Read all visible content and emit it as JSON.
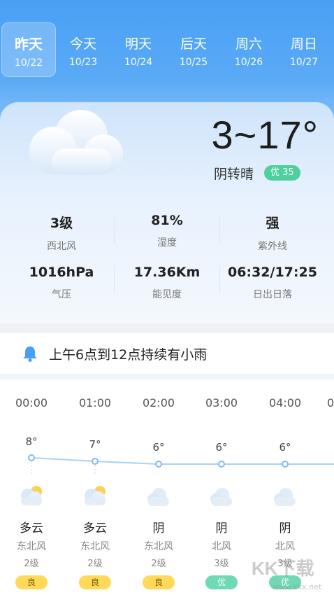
{
  "days": [
    {
      "name": "昨天",
      "date": "10/22",
      "active": true
    },
    {
      "name": "今天",
      "date": "10/23",
      "active": false
    },
    {
      "name": "明天",
      "date": "10/24",
      "active": false
    },
    {
      "name": "后天",
      "date": "10/25",
      "active": false
    },
    {
      "name": "周六",
      "date": "10/26",
      "active": false
    },
    {
      "name": "周日",
      "date": "10/27",
      "active": false
    }
  ],
  "today": {
    "temp_range": "3~17°",
    "condition": "阴转晴",
    "aqi_label": "优 35",
    "aqi_color": "#4fcf9c"
  },
  "stats": [
    {
      "value": "3级",
      "label": "西北风"
    },
    {
      "value": "81%",
      "label": "湿度"
    },
    {
      "value": "强",
      "label": "紫外线"
    },
    {
      "value": "1016hPa",
      "label": "气压"
    },
    {
      "value": "17.36Km",
      "label": "能见度"
    },
    {
      "value": "06:32/17:25",
      "label": "日出日落"
    }
  ],
  "alert": {
    "text": "上午6点到12点持续有小雨",
    "icon": "bell-icon"
  },
  "hourly": [
    {
      "time": "00:00",
      "temp": "8°",
      "icon": "partly-cloudy-icon",
      "weather": "多云",
      "wind_dir": "东北风",
      "wind_level": "2级",
      "aqi": "良",
      "aqi_class": "liang"
    },
    {
      "time": "01:00",
      "temp": "7°",
      "icon": "partly-cloudy-icon",
      "weather": "多云",
      "wind_dir": "东北风",
      "wind_level": "2级",
      "aqi": "良",
      "aqi_class": "liang"
    },
    {
      "time": "02:00",
      "temp": "6°",
      "icon": "cloud-icon",
      "weather": "阴",
      "wind_dir": "东北风",
      "wind_level": "2级",
      "aqi": "良",
      "aqi_class": "liang"
    },
    {
      "time": "03:00",
      "temp": "6°",
      "icon": "cloud-icon",
      "weather": "阴",
      "wind_dir": "北风",
      "wind_level": "3级",
      "aqi": "优",
      "aqi_class": "you"
    },
    {
      "time": "04:00",
      "temp": "6°",
      "icon": "cloud-icon",
      "weather": "阴",
      "wind_dir": "北风",
      "wind_level": "3级",
      "aqi": "优",
      "aqi_class": "you"
    }
  ],
  "hourly_next_partial": {
    "time": "0"
  },
  "watermark": {
    "text": "KK下载",
    "sub": "www.kkx.net"
  },
  "colors": {
    "header_blue": "#4aa0f5",
    "aqi_good": "#4fcf9c",
    "aqi_moderate": "#ffd95a",
    "temp_line": "#a9d2f3"
  }
}
